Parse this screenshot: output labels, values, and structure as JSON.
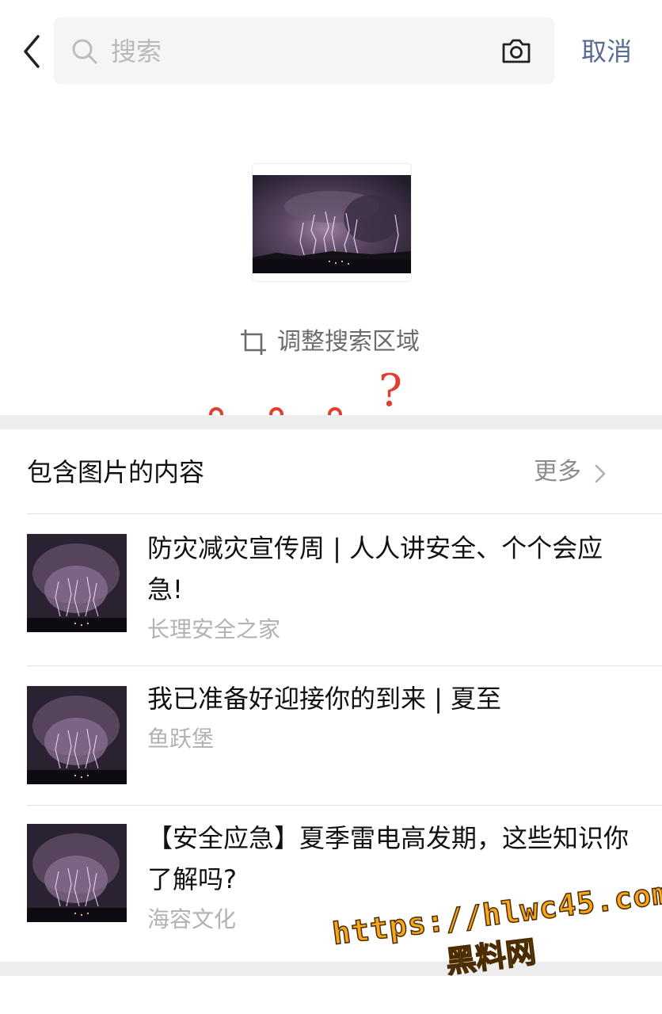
{
  "search": {
    "placeholder": "搜索",
    "cancel_label": "取消",
    "back_icon": "back-arrow-icon",
    "search_icon": "magnifier-icon",
    "camera_icon": "camera-icon"
  },
  "preview": {
    "adjust_label": "调整搜索区域",
    "adjust_icon": "crop-icon"
  },
  "annotation": {
    "question_mark": "?",
    "color": "#e03e2f"
  },
  "section": {
    "title": "包含图片的内容",
    "more_label": "更多"
  },
  "results": [
    {
      "title": "防灾减灾宣传周 | 人人讲安全、个个会应急!",
      "source": "长理安全之家"
    },
    {
      "title": "我已准备好迎接你的到来 | 夏至",
      "source": "鱼跃堡"
    },
    {
      "title": "【安全应急】夏季雷电高发期，这些知识你了解吗?",
      "source": "海容文化"
    }
  ],
  "watermark": {
    "url": "https://hlwc45.com",
    "name": "黑料网"
  },
  "colors": {
    "link_blue": "#576b95",
    "placeholder_gray": "#b9b9b9",
    "secondary_gray": "#b2b2b2",
    "separator": "#ededed",
    "watermark_orange": "#f7a51d"
  }
}
